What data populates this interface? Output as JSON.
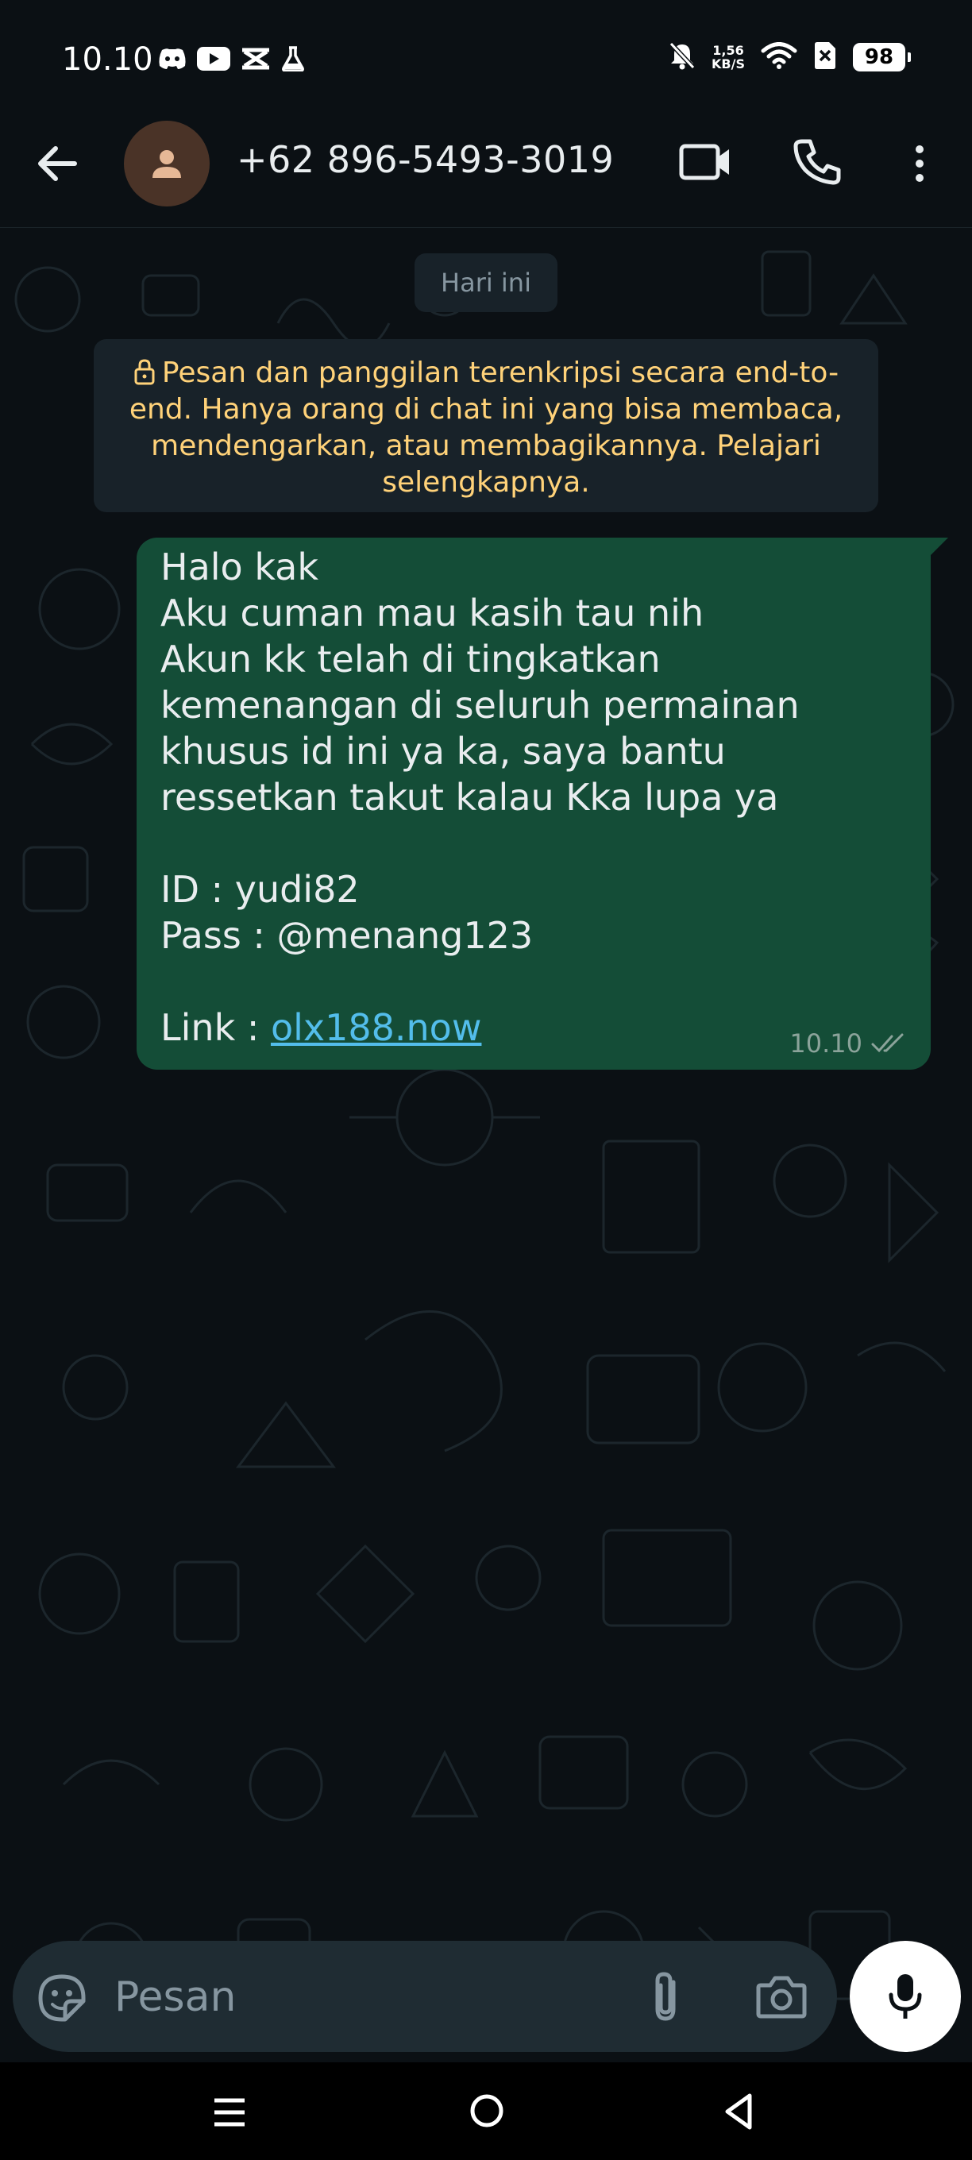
{
  "status_bar": {
    "time": "10.10",
    "net_speed_value": "1,56",
    "net_speed_unit": "KB/S",
    "battery": "98",
    "icons": [
      "discord-icon",
      "youtube-icon",
      "capcut-icon",
      "flask-icon",
      "bell-off-icon",
      "wifi-icon",
      "sim-off-icon",
      "battery-icon"
    ]
  },
  "app_bar": {
    "contact_name": "+62 896-5493-3019",
    "icons": [
      "back-arrow-icon",
      "default-avatar-icon",
      "video-call-icon",
      "phone-call-icon",
      "more-vertical-icon"
    ]
  },
  "chat": {
    "date_chip": "Hari ini",
    "encryption_notice": "Pesan dan panggilan terenkripsi secara end-to-end. Hanya orang di chat ini yang bisa membaca, mendengarkan, atau membagikannya. Pelajari selengkapnya.",
    "message": {
      "lines": [
        "Halo kak",
        "Aku cuman mau kasih tau nih",
        "Akun kk telah di tingkatkan",
        "kemenangan di seluruh permainan",
        "khusus id ini ya ka, saya bantu",
        "ressetkan takut kalau Kka lupa ya",
        "",
        "ID : yudi82",
        "Pass : @menang123",
        ""
      ],
      "link_prefix": "Link : ",
      "link_text": "olx188.now",
      "time": "10.10",
      "status": "read"
    }
  },
  "input_bar": {
    "placeholder": "Pesan",
    "icons": [
      "sticker-icon",
      "paperclip-icon",
      "camera-icon",
      "microphone-icon"
    ]
  },
  "nav_bar": {
    "icons": [
      "recents-menu-icon",
      "home-circle-icon",
      "back-triangle-icon"
    ]
  },
  "colors": {
    "background": "#0b1014",
    "outgoing_bubble": "#144d37",
    "notice_text": "#ffd279",
    "link": "#53bdeb",
    "input_bg": "#1f2c33"
  }
}
